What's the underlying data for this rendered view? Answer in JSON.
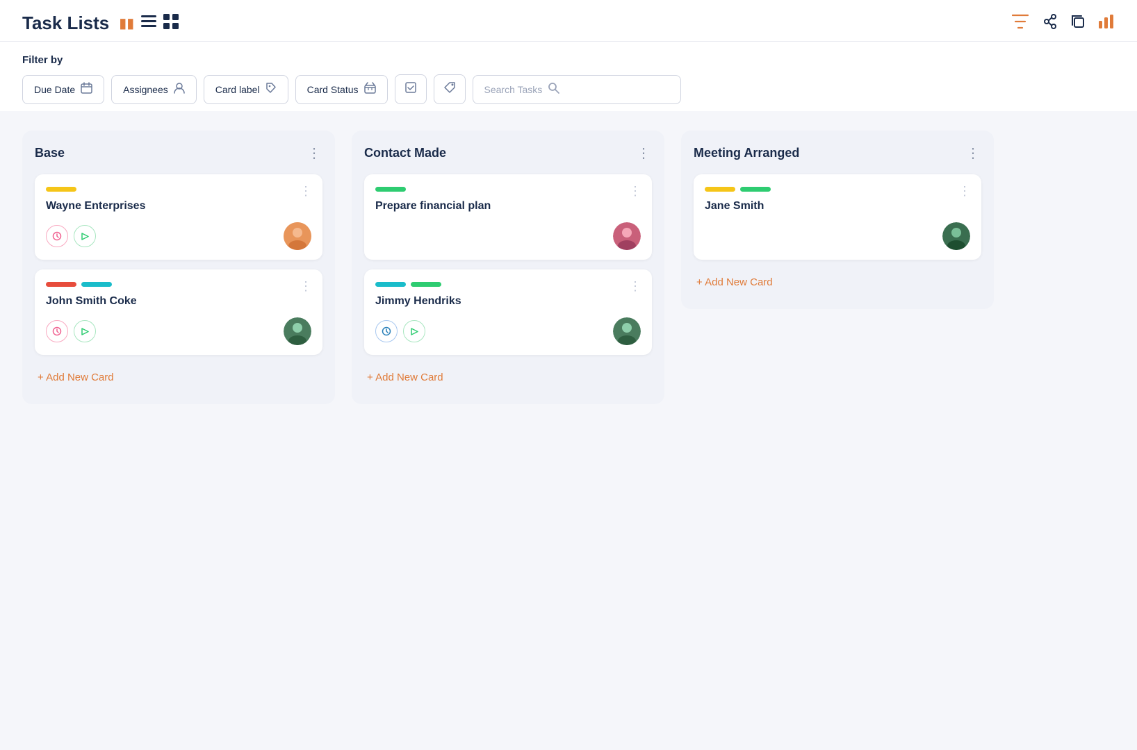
{
  "header": {
    "title": "Task Lists",
    "icons": [
      "▣",
      "☰",
      "⊞"
    ],
    "top_icons": [
      "⛉",
      "◎",
      "⧉",
      "⬛"
    ]
  },
  "filter": {
    "label": "Filter by",
    "buttons": [
      {
        "id": "due-date",
        "label": "Due Date",
        "icon": "📅"
      },
      {
        "id": "assignees",
        "label": "Assignees",
        "icon": "👤"
      },
      {
        "id": "card-label",
        "label": "Card label",
        "icon": "🏷"
      },
      {
        "id": "card-status",
        "label": "Card Status",
        "icon": "📦"
      },
      {
        "id": "check",
        "label": "",
        "icon": "☑"
      },
      {
        "id": "tag",
        "label": "",
        "icon": "🔖"
      }
    ],
    "search": {
      "placeholder": "Search Tasks",
      "icon": "🔍"
    }
  },
  "columns": [
    {
      "id": "base",
      "title": "Base",
      "cards": [
        {
          "id": "wayne",
          "tags": [
            {
              "color": "yellow"
            }
          ],
          "title": "Wayne Enterprises",
          "actions": [
            "clock",
            "play"
          ],
          "avatar_type": "orange",
          "avatar_emoji": "🧑"
        },
        {
          "id": "john",
          "tags": [
            {
              "color": "red"
            },
            {
              "color": "cyan"
            }
          ],
          "title": "John Smith Coke",
          "actions": [
            "clock",
            "play"
          ],
          "avatar_type": "green",
          "avatar_emoji": "🧑"
        }
      ],
      "add_label": "Add New Card"
    },
    {
      "id": "contact-made",
      "title": "Contact Made",
      "cards": [
        {
          "id": "financial",
          "tags": [
            {
              "color": "green"
            }
          ],
          "title": "Prepare financial plan",
          "actions": [],
          "avatar_type": "pink",
          "avatar_emoji": "👩"
        },
        {
          "id": "jimmy",
          "tags": [
            {
              "color": "cyan"
            },
            {
              "color": "green"
            }
          ],
          "title": "Jimmy Hendriks",
          "actions": [
            "clock",
            "play"
          ],
          "avatar_type": "green",
          "avatar_emoji": "🧑"
        }
      ],
      "add_label": "Add New Card"
    },
    {
      "id": "meeting-arranged",
      "title": "Meeting Arranged",
      "cards": [
        {
          "id": "jane",
          "tags": [
            {
              "color": "yellow"
            },
            {
              "color": "green"
            }
          ],
          "title": "Jane Smith",
          "actions": [],
          "avatar_type": "green",
          "avatar_emoji": "🧑"
        }
      ],
      "add_label": "Add New Card"
    }
  ]
}
